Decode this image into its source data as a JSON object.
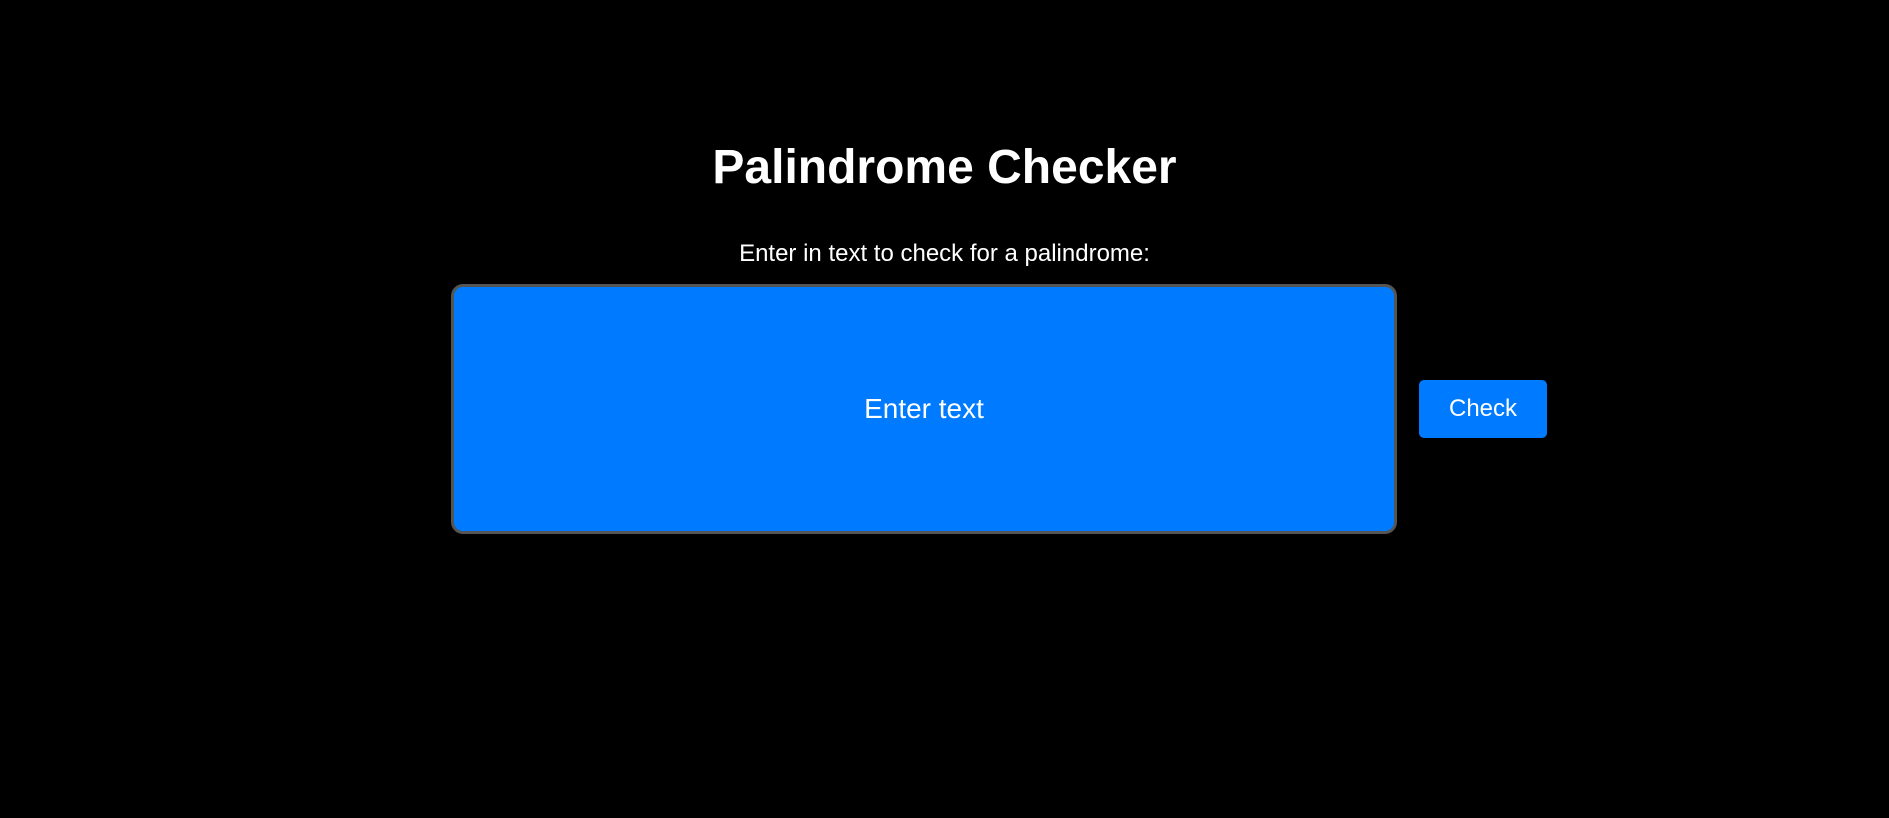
{
  "app": {
    "title": "Palindrome Checker"
  },
  "form": {
    "prompt": "Enter in text to check for a palindrome:",
    "input_value": "",
    "input_placeholder": "Enter text",
    "check_label": "Check"
  },
  "colors": {
    "background": "#000000",
    "accent": "#007bff",
    "text": "#ffffff"
  }
}
